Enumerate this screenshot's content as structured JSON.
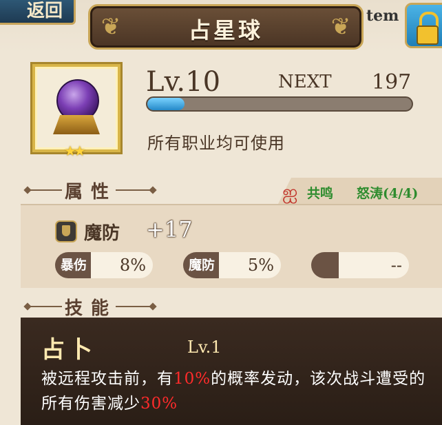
{
  "header": {
    "back_label": "返回",
    "title": "占星球",
    "item_tag": "tem"
  },
  "item": {
    "level_label": "Lv.10",
    "next_label": "NEXT",
    "next_value": "197",
    "exp_fraction": 0.14,
    "usable_text": "所有职业均可使用",
    "stars": "★★"
  },
  "attributes": {
    "section_title": "属性",
    "resonance_label": "共鸣",
    "resonance_skill": "怒涛(4/4)",
    "main_stat": {
      "name": "魔防",
      "value": "+17"
    },
    "sub_stats": [
      {
        "name": "暴伤",
        "value": "8%"
      },
      {
        "name": "魔防",
        "value": "5%"
      },
      {
        "name": "",
        "value": "--"
      }
    ]
  },
  "skill": {
    "section_title": "技能",
    "name": "占卜",
    "level": "Lv.1",
    "desc_1": "被远程攻击前，有",
    "desc_hl1": "10%",
    "desc_2": "的概率发动，该次战斗遭受的所有伤害减少",
    "desc_hl2": "30%"
  },
  "colors": {
    "exp_fill": "#2489c8",
    "highlight": "#ff2b2b",
    "resonance": "#2e8c2e"
  }
}
